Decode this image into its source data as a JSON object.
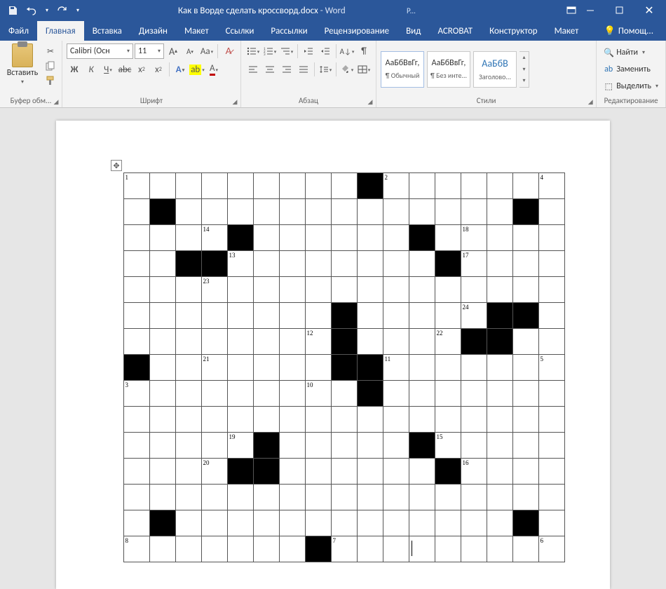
{
  "title": {
    "doc": "Как в Ворде сделать кроссворд.docx",
    "app": "Word"
  },
  "tabs": {
    "file": "Файл",
    "home": "Главная",
    "insert": "Вставка",
    "design": "Дизайн",
    "layout": "Макет",
    "references": "Ссылки",
    "mailings": "Рассылки",
    "review": "Рецензирование",
    "view": "Вид",
    "acrobat": "ACROBAT",
    "konstr": "Конструктор",
    "layout2": "Макет",
    "tell": "Помощ..."
  },
  "extra_tab": "Р...",
  "ribbon": {
    "clipboard": {
      "label": "Буфер обм...",
      "paste": "Вставить"
    },
    "font": {
      "label": "Шрифт",
      "name": "Calibri (Осн",
      "size": "11"
    },
    "paragraph": {
      "label": "Абзац"
    },
    "styles": {
      "label": "Стили",
      "items": [
        {
          "sample": "АаБбВвГг,",
          "name": "¶ Обычный"
        },
        {
          "sample": "АаБбВвГг,",
          "name": "¶ Без инте..."
        },
        {
          "sample": "АаБбВ",
          "name": "Заголово..."
        }
      ]
    },
    "editing": {
      "label": "Редактирование",
      "find": "Найти",
      "replace": "Заменить",
      "select": "Выделить"
    }
  },
  "crossword": {
    "cols": 17,
    "rows": 15,
    "black": [
      [
        0,
        9
      ],
      [
        1,
        1
      ],
      [
        1,
        15
      ],
      [
        2,
        4
      ],
      [
        2,
        11
      ],
      [
        3,
        2
      ],
      [
        3,
        3
      ],
      [
        3,
        12
      ],
      [
        5,
        8
      ],
      [
        5,
        14
      ],
      [
        5,
        15
      ],
      [
        6,
        8
      ],
      [
        6,
        13
      ],
      [
        6,
        14
      ],
      [
        7,
        0
      ],
      [
        7,
        8
      ],
      [
        7,
        9
      ],
      [
        8,
        9
      ],
      [
        10,
        5
      ],
      [
        10,
        11
      ],
      [
        11,
        4
      ],
      [
        11,
        5
      ],
      [
        11,
        12
      ],
      [
        13,
        1
      ],
      [
        13,
        15
      ],
      [
        14,
        7
      ]
    ],
    "numbers": [
      {
        "r": 0,
        "c": 0,
        "n": "1"
      },
      {
        "r": 0,
        "c": 10,
        "n": "2"
      },
      {
        "r": 0,
        "c": 16,
        "n": "4"
      },
      {
        "r": 2,
        "c": 3,
        "n": "14"
      },
      {
        "r": 2,
        "c": 13,
        "n": "18"
      },
      {
        "r": 3,
        "c": 4,
        "n": "13"
      },
      {
        "r": 3,
        "c": 13,
        "n": "17"
      },
      {
        "r": 4,
        "c": 3,
        "n": "23"
      },
      {
        "r": 5,
        "c": 13,
        "n": "24"
      },
      {
        "r": 6,
        "c": 7,
        "n": "12"
      },
      {
        "r": 6,
        "c": 12,
        "n": "22"
      },
      {
        "r": 7,
        "c": 3,
        "n": "21"
      },
      {
        "r": 7,
        "c": 10,
        "n": "11"
      },
      {
        "r": 7,
        "c": 16,
        "n": "5"
      },
      {
        "r": 8,
        "c": 0,
        "n": "3"
      },
      {
        "r": 8,
        "c": 7,
        "n": "10"
      },
      {
        "r": 10,
        "c": 4,
        "n": "19"
      },
      {
        "r": 10,
        "c": 12,
        "n": "15"
      },
      {
        "r": 11,
        "c": 3,
        "n": "20"
      },
      {
        "r": 11,
        "c": 13,
        "n": "16"
      },
      {
        "r": 14,
        "c": 0,
        "n": "8"
      },
      {
        "r": 14,
        "c": 8,
        "n": "7"
      },
      {
        "r": 14,
        "c": 16,
        "n": "6"
      }
    ],
    "cursor": {
      "r": 14,
      "c": 11
    }
  }
}
